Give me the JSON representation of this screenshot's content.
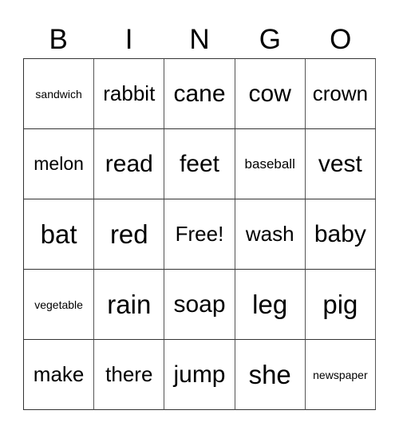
{
  "header": [
    "B",
    "I",
    "N",
    "G",
    "O"
  ],
  "cells": [
    [
      {
        "text": "sandwich",
        "size": "s-xxs"
      },
      {
        "text": "rabbit",
        "size": "s-m"
      },
      {
        "text": "cane",
        "size": "s-l"
      },
      {
        "text": "cow",
        "size": "s-l"
      },
      {
        "text": "crown",
        "size": "s-m"
      }
    ],
    [
      {
        "text": "melon",
        "size": "s-s"
      },
      {
        "text": "read",
        "size": "s-l"
      },
      {
        "text": "feet",
        "size": "s-l"
      },
      {
        "text": "baseball",
        "size": "s-xs"
      },
      {
        "text": "vest",
        "size": "s-l"
      }
    ],
    [
      {
        "text": "bat",
        "size": "s-xl"
      },
      {
        "text": "red",
        "size": "s-xl"
      },
      {
        "text": "Free!",
        "size": "s-m"
      },
      {
        "text": "wash",
        "size": "s-m"
      },
      {
        "text": "baby",
        "size": "s-l"
      }
    ],
    [
      {
        "text": "vegetable",
        "size": "s-xxs"
      },
      {
        "text": "rain",
        "size": "s-xl"
      },
      {
        "text": "soap",
        "size": "s-l"
      },
      {
        "text": "leg",
        "size": "s-xl"
      },
      {
        "text": "pig",
        "size": "s-xl"
      }
    ],
    [
      {
        "text": "make",
        "size": "s-m"
      },
      {
        "text": "there",
        "size": "s-m"
      },
      {
        "text": "jump",
        "size": "s-l"
      },
      {
        "text": "she",
        "size": "s-xl"
      },
      {
        "text": "newspaper",
        "size": "s-xxs"
      }
    ]
  ]
}
